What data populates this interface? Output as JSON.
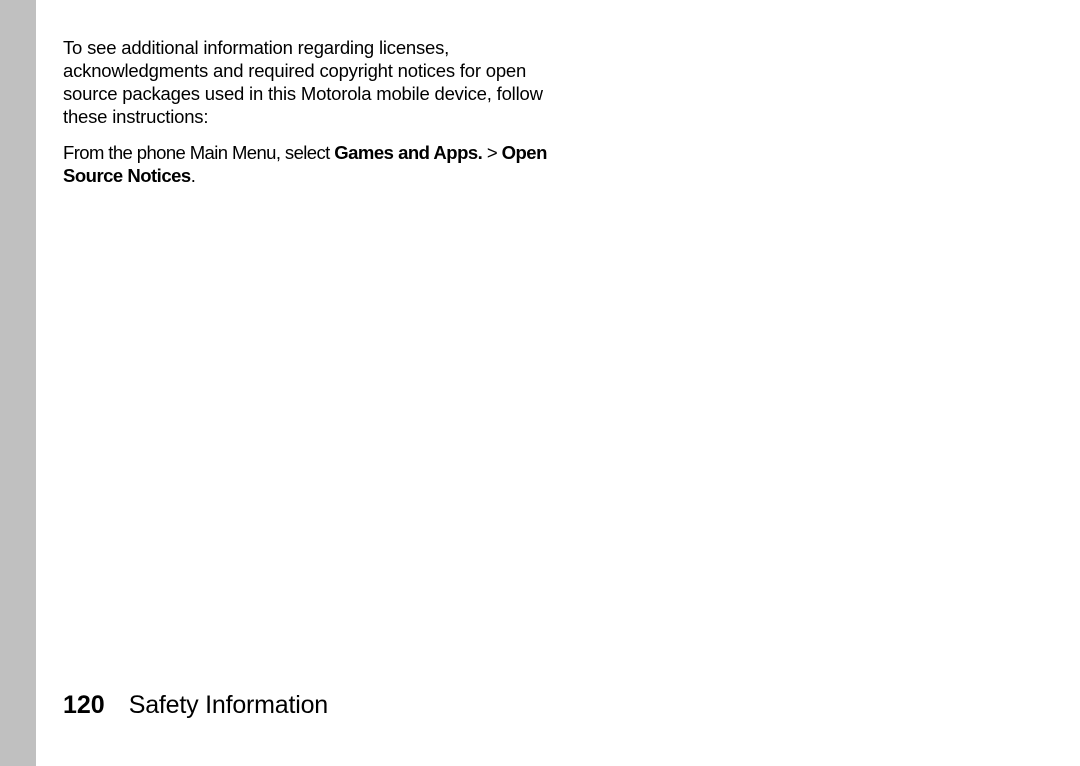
{
  "content": {
    "paragraph1": "To see additional information regarding licenses, acknowledgments and required copyright notices for open source packages used in this Motorola mobile device, follow these instructions:",
    "instruction_prefix": "From the phone Main Menu, select ",
    "bold1": "Games and Apps.",
    "separator": " > ",
    "bold2": "Open Source Notices",
    "instruction_suffix": "."
  },
  "footer": {
    "page_number": "120",
    "section_title": "Safety Information"
  }
}
